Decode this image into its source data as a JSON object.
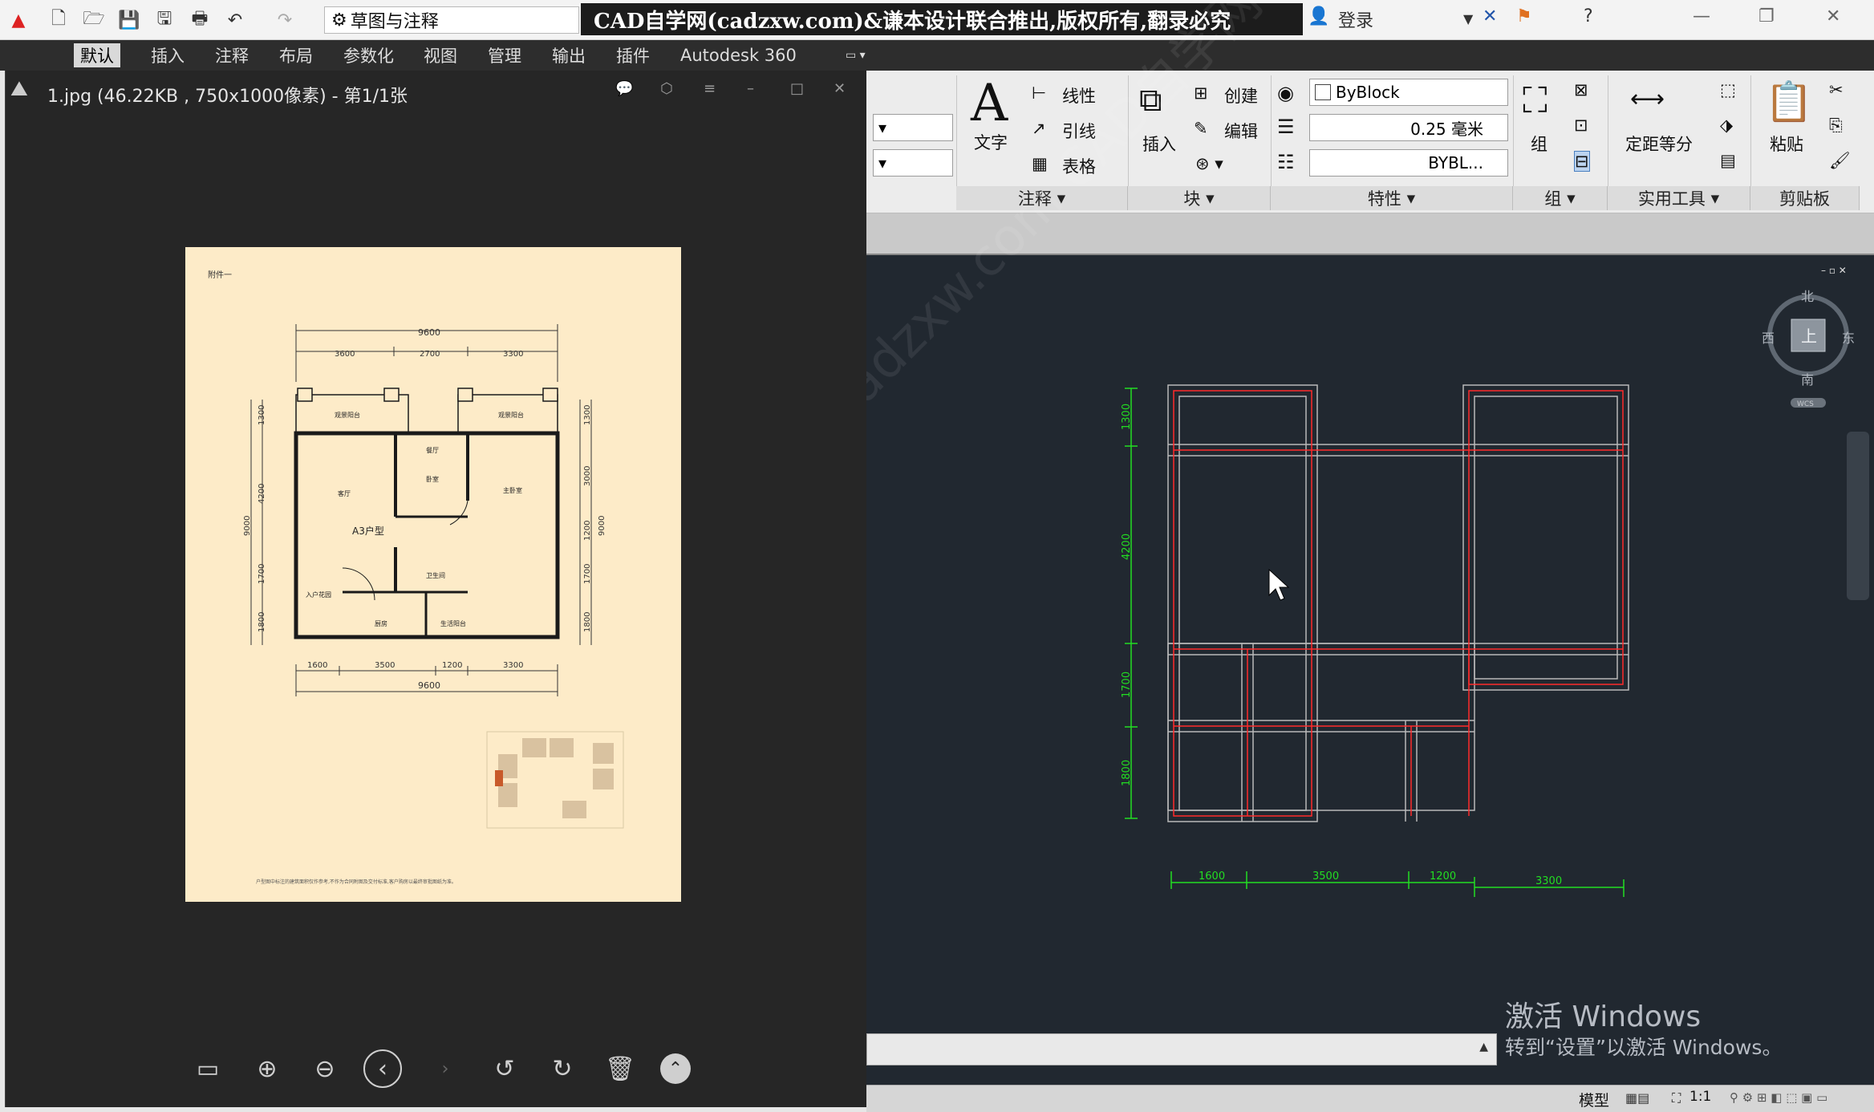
{
  "titlebar": {
    "workspace": "草图与注释",
    "banner": "CAD自学网(cadzxw.com)&谦本设计联合推出,版权所有,翻录必究",
    "login": "登录",
    "help": "?"
  },
  "menu": [
    "默认",
    "插入",
    "注释",
    "布局",
    "参数化",
    "视图",
    "管理",
    "输出",
    "插件",
    "Autodesk 360"
  ],
  "viewer": {
    "title": "1.jpg (46.22KB , 750x1000像素) - 第1/1张",
    "doc": {
      "appendix": "附件一",
      "unit_label": "A3户型",
      "rooms": [
        "观景阳台",
        "观景阳台",
        "客厅",
        "卧室",
        "主卧室",
        "卫生间",
        "入户花园",
        "厨房",
        "生活阳台",
        "餐厅"
      ],
      "top_total": "9600",
      "top_dims": [
        "3600",
        "2700",
        "3300"
      ],
      "bottom_dims": [
        "1600",
        "3500",
        "1200",
        "3300"
      ],
      "bottom_total": "9600",
      "left_dims": [
        "1300",
        "4200",
        "1700",
        "1800"
      ],
      "left_total": "9000",
      "right_dims": [
        "1300",
        "3000",
        "1200",
        "1700",
        "1800"
      ],
      "right_total": "9000",
      "footnote": "户型图中标注的建筑面积仅作参考,不作为合同附图及交付标准,客户购房以最终审批图纸为准。"
    }
  },
  "ribbon": {
    "text": "文字",
    "linear": "线性",
    "leader": "引线",
    "table": "表格",
    "insert": "插入",
    "create": "创建",
    "edit": "编辑",
    "byblock": "ByBlock",
    "lineweight": "0.25 毫米",
    "linetype": "BYBL...",
    "group": "组",
    "measure": "定距等分",
    "paste": "粘贴",
    "panels": [
      "注释",
      "块",
      "特性",
      "组",
      "实用工具",
      "剪贴板"
    ]
  },
  "cad": {
    "v_dims": [
      "1300",
      "4200",
      "1700",
      "1800"
    ],
    "h_dims": [
      "1600",
      "3500",
      "1200",
      "3300"
    ],
    "compass": {
      "n": "北",
      "s": "南",
      "e": "东",
      "w": "西",
      "top": "上",
      "wcs": "WCS"
    },
    "watermark": "www.cadzxw.com  CAD自学网"
  },
  "status": {
    "model": "模型",
    "scale": "1:1"
  },
  "activation": {
    "line1": "激活 Windows",
    "line2": "转到“设置”以激活 Windows。"
  },
  "colors": {
    "wall": "#ff2b2b",
    "dim": "#22dd22",
    "canvas": "#212830"
  }
}
